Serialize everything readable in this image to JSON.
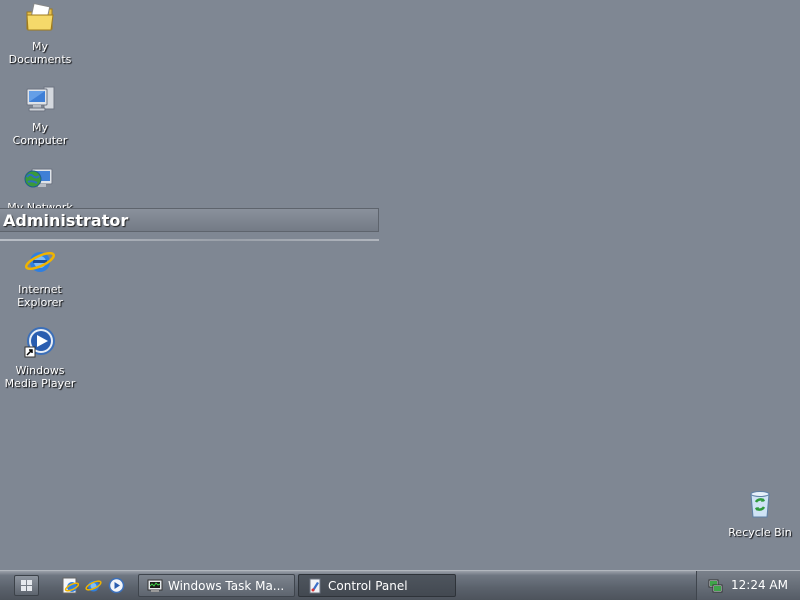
{
  "desktop": {
    "background_color": "#7f8793",
    "icons": [
      {
        "label": "My\nDocuments",
        "icon": "my-documents-icon"
      },
      {
        "label": "My\nComputer",
        "icon": "my-computer-icon"
      },
      {
        "label": "My Network",
        "icon": "my-network-places-icon"
      },
      {
        "label": "Internet\nExplorer",
        "icon": "internet-explorer-icon"
      },
      {
        "label": "Windows\nMedia Player",
        "icon": "windows-media-player-icon"
      },
      {
        "label": "Recycle Bin",
        "icon": "recycle-bin-icon"
      }
    ]
  },
  "start_menu_header": {
    "user_name": "Administrator"
  },
  "taskbar": {
    "start_icon": "start-button-icon",
    "quick_launch": [
      "internet-explorer-icon",
      "internet-explorer-icon",
      "windows-media-player-icon"
    ],
    "tasks": [
      {
        "label": "Windows Task Ma...",
        "icon": "task-manager-icon",
        "active": false
      },
      {
        "label": "Control Panel",
        "icon": "control-panel-icon",
        "active": true
      }
    ],
    "tray": {
      "icon": "network-tray-icon",
      "time": "12:24 AM"
    }
  }
}
